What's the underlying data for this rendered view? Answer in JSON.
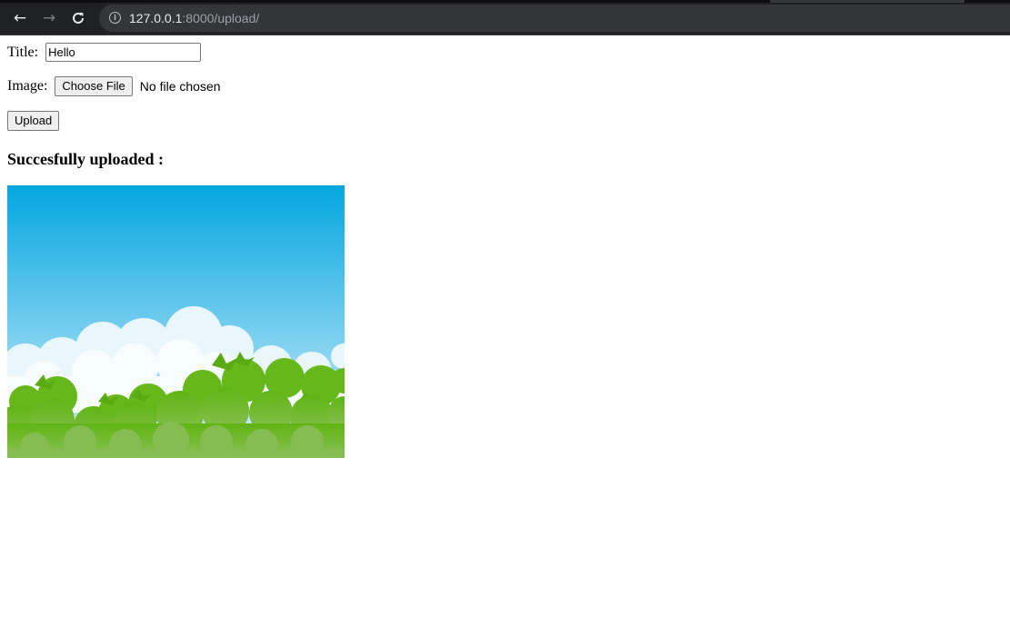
{
  "browser": {
    "url_host": "127.0.0.1",
    "url_path": ":8000/upload/"
  },
  "form": {
    "title_label": "Title:",
    "title_value": "Hello",
    "image_label": "Image:",
    "choose_file_label": "Choose File",
    "file_status": "No file chosen",
    "upload_label": "Upload"
  },
  "result": {
    "heading": "Succesfully uploaded :"
  },
  "colors": {
    "sky_top": "#04a7df",
    "sky_bottom": "#bfe6f6",
    "grass": "#6fbb1f"
  }
}
